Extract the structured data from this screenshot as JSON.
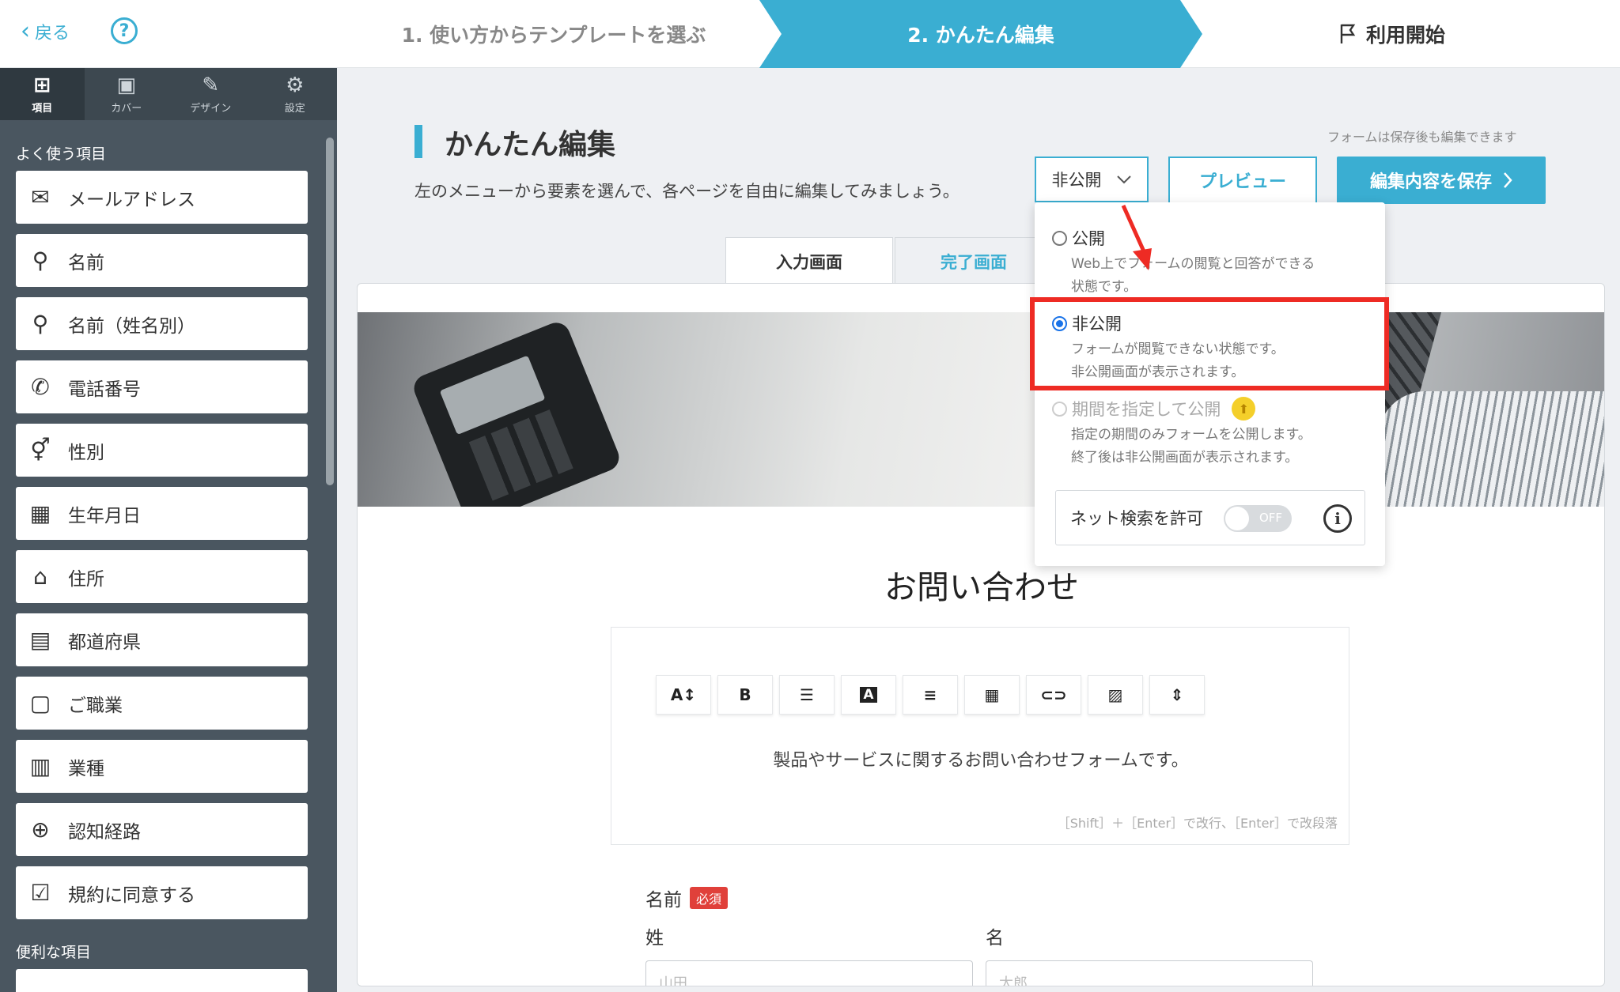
{
  "topbar": {
    "back_label": "戻る",
    "help_icon": "?",
    "step1": "1. 使い方からテンプレートを選ぶ",
    "step2": "2. かんたん編集",
    "step3": "利用開始"
  },
  "sidebar": {
    "tabs": [
      {
        "label": "項目",
        "icon": "⊞"
      },
      {
        "label": "カバー",
        "icon": "▣"
      },
      {
        "label": "デザイン",
        "icon": "✎"
      },
      {
        "label": "設定",
        "icon": "⚙"
      }
    ],
    "section1": "よく使う項目",
    "section2": "便利な項目",
    "items": [
      {
        "label": "メールアドレス",
        "icon": "✉"
      },
      {
        "label": "名前",
        "icon": "⚲"
      },
      {
        "label": "名前（姓名別）",
        "icon": "⚲"
      },
      {
        "label": "電話番号",
        "icon": "✆"
      },
      {
        "label": "性別",
        "icon": "⚥"
      },
      {
        "label": "生年月日",
        "icon": "▦"
      },
      {
        "label": "住所",
        "icon": "⌂"
      },
      {
        "label": "都道府県",
        "icon": "▤"
      },
      {
        "label": "ご職業",
        "icon": "▢"
      },
      {
        "label": "業種",
        "icon": "▥"
      },
      {
        "label": "認知経路",
        "icon": "⊕"
      },
      {
        "label": "規約に同意する",
        "icon": "☑"
      }
    ]
  },
  "main": {
    "title": "かんたん編集",
    "description": "左のメニューから要素を選んで、各ページを自由に編集してみましょう。",
    "note": "フォームは保存後も編集できます",
    "visibility_select": "非公開",
    "preview_button": "プレビュー",
    "save_button": "編集内容を保存",
    "tabs": [
      "入力画面",
      "完了画面"
    ]
  },
  "form": {
    "title": "お問い合わせ",
    "toolbar": [
      "A↕",
      "B",
      "☰",
      "A",
      "≡",
      "▦",
      "⊂⊃",
      "▨",
      "⇕"
    ],
    "description": "製品やサービスに関するお問い合わせフォームです。",
    "hint": "［Shift］＋［Enter］で改行、［Enter］で改段落",
    "field_label": "名前",
    "required": "必須",
    "last_name_label": "姓",
    "first_name_label": "名",
    "last_name_placeholder": "山田",
    "first_name_placeholder": "太郎"
  },
  "dropdown": {
    "options": [
      {
        "label": "公開",
        "desc1": "Web上でフォームの閲覧と回答ができる",
        "desc2": "状態です。"
      },
      {
        "label": "非公開",
        "desc1": "フォームが閲覧できない状態です。",
        "desc2": "非公開画面が表示されます。"
      },
      {
        "label": "期間を指定して公開",
        "desc1": "指定の期間のみフォームを公開します。",
        "desc2": "終了後は非公開画面が表示されます。"
      }
    ],
    "net_search_label": "ネット検索を許可",
    "toggle_state": "OFF",
    "info_icon": "i"
  },
  "colors": {
    "accent": "#3aaed2",
    "highlight": "#ee2b24",
    "sidebar": "#4a5660"
  }
}
